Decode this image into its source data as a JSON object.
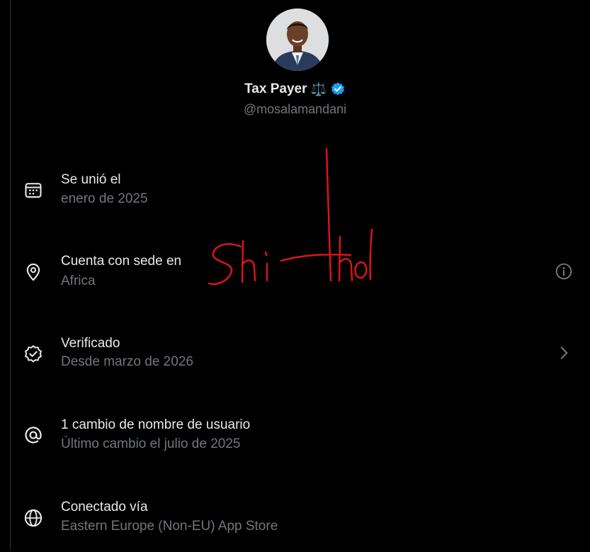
{
  "profile": {
    "display_name": "Tax Payer",
    "name_emoji": "⚖️",
    "handle": "@mosalamandani"
  },
  "rows": [
    {
      "title": "Se unió el",
      "subtitle": "enero de 2025",
      "icon": "calendar-icon"
    },
    {
      "title": "Cuenta con sede en",
      "subtitle": "Africa",
      "icon": "location-pin-icon",
      "right_icon": "info-icon"
    },
    {
      "title": "Verificado",
      "subtitle": "Desde marzo de 2026",
      "icon": "verified-badge-icon",
      "right_icon": "chevron-right-icon"
    },
    {
      "title": "1 cambio de nombre de usuario",
      "subtitle": "Último cambio el julio de 2025",
      "icon": "at-sign-icon"
    },
    {
      "title": "Conectado vía",
      "subtitle": "Eastern Europe (Non-EU) App Store",
      "icon": "globe-icon"
    }
  ],
  "annotation": {
    "handwritten_text": "Shithole",
    "color": "#e0141e"
  },
  "colors": {
    "background": "#000000",
    "primary_text": "#e7e9ea",
    "secondary_text": "#71767b",
    "verified_blue": "#1d9bf0"
  }
}
